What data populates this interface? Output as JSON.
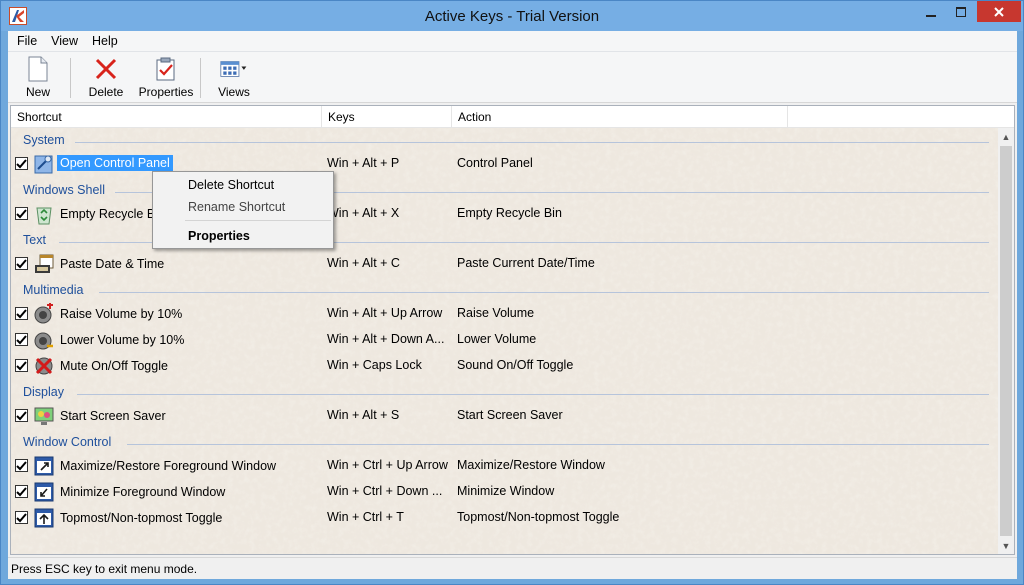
{
  "window": {
    "title": "Active Keys - Trial Version"
  },
  "menu": [
    "File",
    "View",
    "Help"
  ],
  "toolbar": {
    "new_label": "New",
    "delete_label": "Delete",
    "properties_label": "Properties",
    "views_label": "Views"
  },
  "columns": {
    "shortcut": "Shortcut",
    "keys": "Keys",
    "action": "Action"
  },
  "groups": {
    "system": "System",
    "windows_shell": "Windows Shell",
    "text": "Text",
    "multimedia": "Multimedia",
    "display": "Display",
    "window_control": "Window Control"
  },
  "rows": [
    {
      "name": "Open Control Panel",
      "keys": "Win + Alt + P",
      "action": "Control Panel",
      "checked": true,
      "selected": true,
      "icon": "control-panel-icon"
    },
    {
      "name": "Empty Recycle Bin",
      "keys": "Win + Alt + X",
      "action": "Empty Recycle Bin",
      "checked": true,
      "icon": "recycle-bin-icon"
    },
    {
      "name": "Paste Date & Time",
      "keys": "Win + Alt + C",
      "action": "Paste Current Date/Time",
      "checked": true,
      "icon": "calendar-clock-icon"
    },
    {
      "name": "Raise Volume by 10%",
      "keys": "Win + Alt + Up Arrow",
      "action": "Raise Volume",
      "checked": true,
      "icon": "volume-up-icon"
    },
    {
      "name": "Lower Volume by 10%",
      "keys": "Win + Alt + Down A...",
      "action": "Lower Volume",
      "checked": true,
      "icon": "volume-down-icon"
    },
    {
      "name": "Mute On/Off Toggle",
      "keys": "Win + Caps Lock",
      "action": "Sound On/Off Toggle",
      "checked": true,
      "icon": "mute-icon"
    },
    {
      "name": "Start Screen Saver",
      "keys": "Win + Alt + S",
      "action": "Start Screen Saver",
      "checked": true,
      "icon": "screen-saver-icon"
    },
    {
      "name": "Maximize/Restore Foreground Window",
      "keys": "Win + Ctrl + Up Arrow",
      "action": "Maximize/Restore Window",
      "checked": true,
      "icon": "window-maximize-icon"
    },
    {
      "name": "Minimize Foreground Window",
      "keys": "Win + Ctrl + Down ...",
      "action": "Minimize Window",
      "checked": true,
      "icon": "window-minimize-icon"
    },
    {
      "name": "Topmost/Non-topmost Toggle",
      "keys": "Win + Ctrl + T",
      "action": "Topmost/Non-topmost Toggle",
      "checked": true,
      "icon": "window-topmost-icon"
    }
  ],
  "context_menu": {
    "delete": "Delete Shortcut",
    "rename": "Rename Shortcut",
    "properties": "Properties"
  },
  "status": "Press ESC key to exit menu mode.",
  "colors": {
    "titlebar": "#76aee4",
    "selection": "#3399ff",
    "group_text": "#1e4f9b",
    "close_button": "#c7372f"
  }
}
